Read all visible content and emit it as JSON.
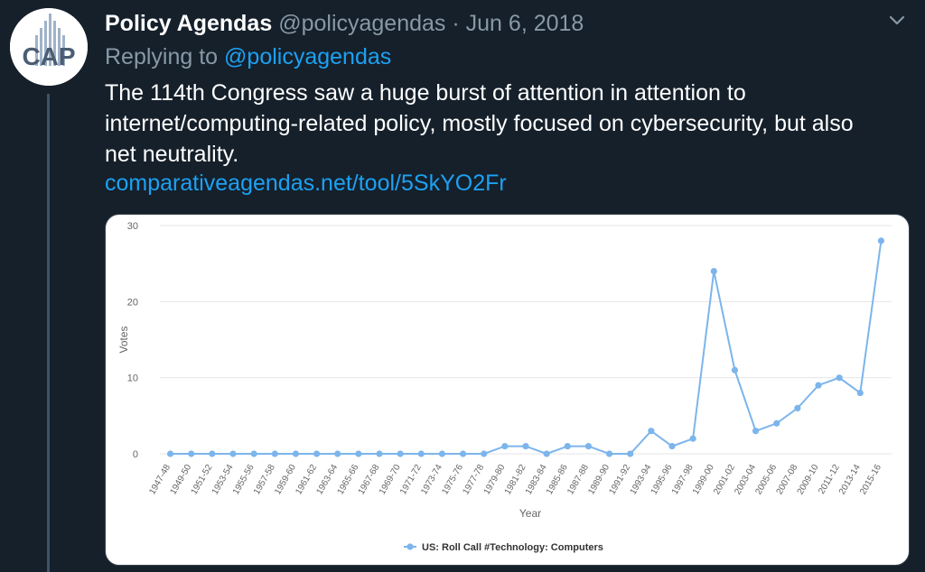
{
  "author": {
    "name": "Policy Agendas",
    "handle": "@policyagendas",
    "separator": "·",
    "date": "Jun 6, 2018",
    "avatar_text": "CAP"
  },
  "reply": {
    "prefix": "Replying to",
    "mention": "@policyagendas"
  },
  "tweet": {
    "line1": "The 114th Congress saw a huge burst of attention in attention to",
    "line2": "internet/computing-related policy, mostly focused on cybersecurity, but also",
    "line3": "net neutrality.",
    "link": "comparativeagendas.net/tool/5SkYO2Fr"
  },
  "colors": {
    "background": "#15202b",
    "accent": "#1da1f2",
    "muted": "#8899a6",
    "series": "#7cb5ec"
  },
  "icons": {
    "menu": "chevron-down-icon"
  },
  "chart_data": {
    "type": "line",
    "xlabel": "Year",
    "ylabel": "Votes",
    "ylim": [
      0,
      30
    ],
    "yticks": [
      0,
      10,
      20,
      30
    ],
    "grid": true,
    "legend_position": "bottom-center",
    "categories": [
      "1947-48",
      "1949-50",
      "1951-52",
      "1953-54",
      "1955-56",
      "1957-58",
      "1959-60",
      "1961-62",
      "1963-64",
      "1965-66",
      "1967-68",
      "1969-70",
      "1971-72",
      "1973-74",
      "1975-76",
      "1977-78",
      "1979-80",
      "1981-82",
      "1983-84",
      "1985-86",
      "1987-88",
      "1989-90",
      "1991-92",
      "1993-94",
      "1995-96",
      "1997-98",
      "1999-00",
      "2001-02",
      "2003-04",
      "2005-06",
      "2007-08",
      "2009-10",
      "2011-12",
      "2013-14",
      "2015-16"
    ],
    "series": [
      {
        "name": "US: Roll Call #Technology: Computers",
        "values": [
          0,
          0,
          0,
          0,
          0,
          0,
          0,
          0,
          0,
          0,
          0,
          0,
          0,
          0,
          0,
          0,
          1,
          1,
          0,
          1,
          1,
          0,
          0,
          3,
          1,
          2,
          24,
          11,
          3,
          4,
          6,
          9,
          10,
          8,
          28
        ]
      }
    ]
  }
}
